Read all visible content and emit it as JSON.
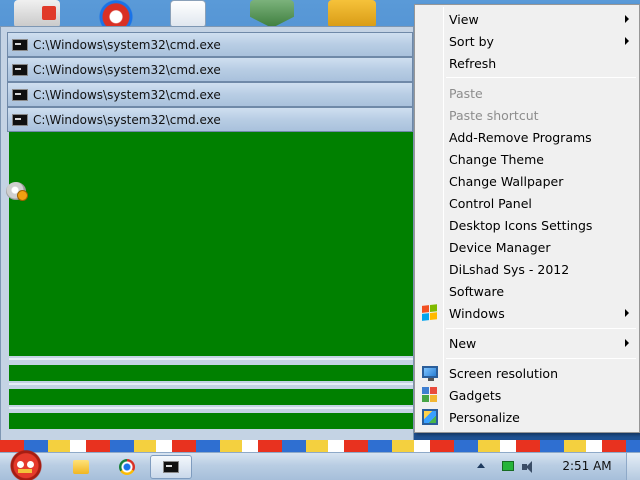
{
  "cmd_windows": {
    "titles": [
      "C:\\Windows\\system32\\cmd.exe",
      "C:\\Windows\\system32\\cmd.exe",
      "C:\\Windows\\system32\\cmd.exe",
      "C:\\Windows\\system32\\cmd.exe"
    ],
    "console_background": "#008000"
  },
  "context_menu": {
    "items": {
      "view": "View",
      "sort_by": "Sort by",
      "refresh": "Refresh",
      "paste": "Paste",
      "paste_shortcut": "Paste shortcut",
      "add_remove_programs": "Add-Remove Programs",
      "change_theme": "Change Theme",
      "change_wallpaper": "Change Wallpaper",
      "control_panel": "Control Panel",
      "desktop_icons_settings": "Desktop Icons Settings",
      "device_manager": "Device Manager",
      "dilshad_sys": "DiLshad Sys - 2012",
      "software": "Software",
      "windows": "Windows",
      "new": "New",
      "screen_resolution": "Screen resolution",
      "gadgets": "Gadgets",
      "personalize": "Personalize"
    },
    "disabled_color": "#8d8d8d"
  },
  "taskbar": {
    "clock": "2:51 AM",
    "pinned": [
      "windows-explorer-icon",
      "chrome-icon",
      "cmd-icon"
    ]
  }
}
